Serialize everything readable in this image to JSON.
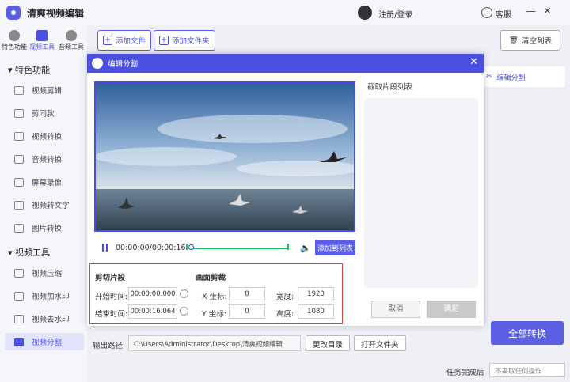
{
  "app": {
    "title": "清爽视频编辑",
    "login": "注册/登录",
    "service": "客服"
  },
  "sidebar": {
    "top_tabs": [
      "特色功能",
      "视频工具",
      "音频工具"
    ],
    "sections": [
      {
        "label": "特色功能",
        "items": [
          "视频剪辑",
          "剪同款",
          "视频转换",
          "音频转换",
          "屏幕录像",
          "视频转文字",
          "图片转换"
        ]
      },
      {
        "label": "视频工具",
        "items": [
          "视频压缩",
          "视频加水印",
          "视频去水印",
          "视频分割"
        ]
      }
    ]
  },
  "toolbar": {
    "add_file": "添加文件",
    "add_folder": "添加文件夹",
    "clear_list": "清空列表"
  },
  "right_tag": "编辑分割",
  "convert_all": "全部转换",
  "output": {
    "label": "输出路径:",
    "path": "C:\\Users\\Administrator\\Desktop\\清爽视频编辑",
    "change_dir": "更改目录",
    "open_folder": "打开文件夹"
  },
  "after_done": {
    "label": "任务完成后",
    "value": "不采取任何操作"
  },
  "dialog": {
    "title": "编辑分割",
    "segment_list_title": "截取片段列表",
    "time": "00:00:00/00:00:16",
    "add_to_list": "添加到列表",
    "cancel": "取消",
    "ok": "确定",
    "clip": {
      "title": "剪切片段",
      "start_label": "开始时间:",
      "start_value": "00:00:00.000",
      "end_label": "结束时间:",
      "end_value": "00:00:16.064"
    },
    "crop": {
      "title": "画面剪裁",
      "x_label": "X 坐标:",
      "x_value": "0",
      "y_label": "Y 坐标:",
      "y_value": "0",
      "width_label": "宽度:",
      "width_value": "1920",
      "height_label": "高度:",
      "height_value": "1080"
    }
  },
  "colors": {
    "accent": "#5b5fe6",
    "highlight_border": "#e14040",
    "track": "#21c162"
  }
}
